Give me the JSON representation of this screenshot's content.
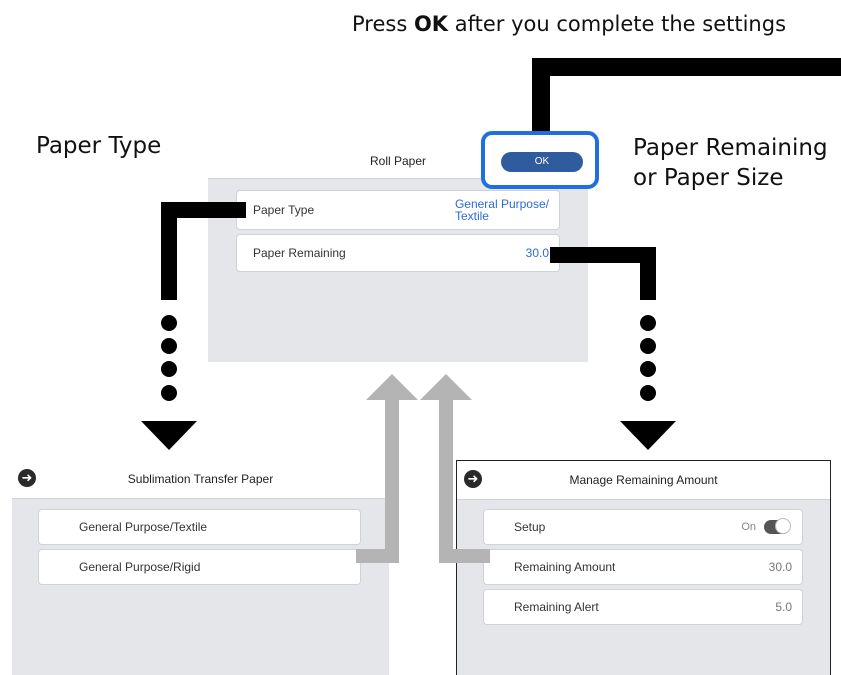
{
  "captions": {
    "top_prefix": "Press ",
    "top_bold": "OK",
    "top_suffix": " after you complete the settings",
    "left": "Paper Type",
    "right_line1": "Paper Remaining",
    "right_line2": "or Paper Size"
  },
  "main_screen": {
    "title": "Roll Paper",
    "ok_label": "OK",
    "rows": [
      {
        "label": "Paper Type",
        "value_line1": "General Purpose/",
        "value_line2": "Textile"
      },
      {
        "label": "Paper Remaining",
        "value": "30.0"
      }
    ]
  },
  "left_screen": {
    "title": "Sublimation Transfer Paper",
    "back_icon": "arrow-left-icon",
    "items": [
      "General Purpose/Textile",
      "General Purpose/Rigid"
    ]
  },
  "right_screen": {
    "title": "Manage Remaining Amount",
    "back_icon": "arrow-left-icon",
    "rows": [
      {
        "label": "Setup",
        "value": "On",
        "toggle": true
      },
      {
        "label": "Remaining Amount",
        "value": "30.0"
      },
      {
        "label": "Remaining Alert",
        "value": "5.0"
      }
    ]
  },
  "colors": {
    "ok_button": "#2f5c9e",
    "highlight_outline": "#1f6fe0",
    "value_blue": "#2b6bd6",
    "arrow_gray": "#b4b4b4",
    "connector_black": "#000000"
  }
}
